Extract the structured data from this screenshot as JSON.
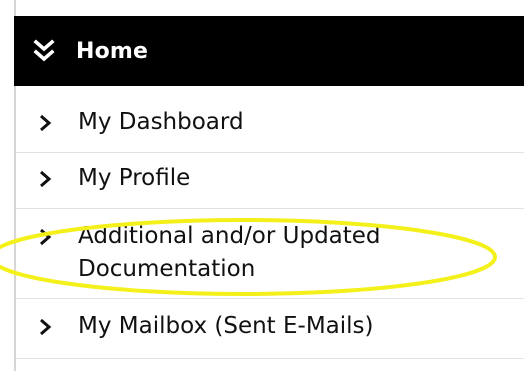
{
  "nav": {
    "header": {
      "label": "Home",
      "icon": "double-chevron-down-icon"
    },
    "items": [
      {
        "label": "My Dashboard",
        "icon": "chevron-right-icon"
      },
      {
        "label": "My Profile",
        "icon": "chevron-right-icon"
      },
      {
        "label": "Additional and/or Updated Documentation",
        "icon": "chevron-right-icon",
        "highlighted": true
      },
      {
        "label": "My Mailbox (Sent E-Mails)",
        "icon": "chevron-right-icon"
      }
    ]
  },
  "colors": {
    "header_bg": "#000000",
    "header_text": "#ffffff",
    "item_text": "#111111",
    "highlight_annotation": "#f3f01a"
  }
}
